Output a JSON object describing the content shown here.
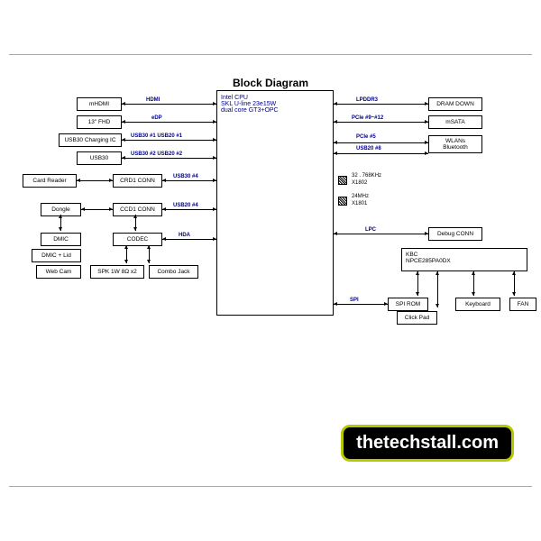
{
  "title": "Block Diagram",
  "cpu": {
    "line1": "Intel CPU",
    "line2": "SKL U-line 23e15W",
    "line3": "dual core GT3+OPC"
  },
  "left_blocks": {
    "mhdmi": "mHDMI",
    "fhd": "13\" FHD",
    "usb30_charging": "USB30 Charging IC",
    "usb30": "USB30",
    "card_reader": "Card Reader",
    "crd1": "CRD1 CONN",
    "dongle": "Dongle",
    "ccd1": "CCD1 CONN",
    "dmic": "DMIC",
    "dmic_lid": "DMIC + Lid",
    "web_cam": "Web Cam",
    "codec": "CODEC",
    "spk": "SPK 1W 8Ω x2",
    "combo": "Combo Jack"
  },
  "right_blocks": {
    "dram": "DRAM DOWN",
    "msata": "mSATA",
    "wlan": "WLANs\nBluetooth",
    "debug": "Debug CONN",
    "kbc": "KBC\nNPCE285PA0DX",
    "spi_rom": "SPI ROM",
    "clickpad": "Click Pad",
    "keyboard": "Keyboard",
    "fan": "FAN"
  },
  "connectors": {
    "hdmi": "HDMI",
    "edp": "eDP",
    "usb30_1": "USB30 #1 USB20 #1",
    "usb30_2": "USB30 #2 USB20 #2",
    "usb30_4": "USB30 #4",
    "usb20_4": "USB20 #4",
    "hda": "HDA",
    "lpddr3": "LPDDR3",
    "pcie9_12": "PCIe #9~#12",
    "pcie5": "PCIe #5",
    "usb20_8": "USB20 #8",
    "lpc": "LPC",
    "spi": "SPI"
  },
  "crystals": {
    "c1": "32 . 768KHz",
    "c1b": "X1802",
    "c2": "24MHz",
    "c2b": "X1801"
  },
  "watermark": "thetechstall.com"
}
